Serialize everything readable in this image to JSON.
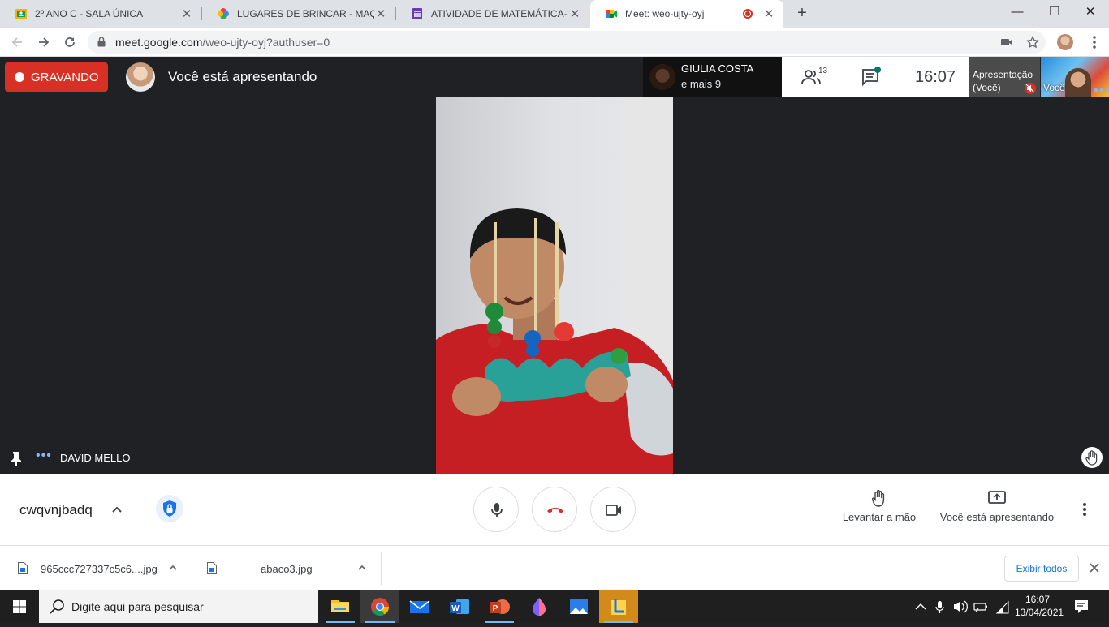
{
  "browser": {
    "tabs": [
      {
        "title": "2º ANO C - SALA ÚNICA",
        "icon": "classroom-icon"
      },
      {
        "title": "LUGARES DE BRINCAR - MAQUETE",
        "icon": "google-photos-icon"
      },
      {
        "title": "ATIVIDADE DE MATEMÁTICA- SISTE",
        "icon": "google-forms-icon"
      },
      {
        "title": "Meet: weo-ujty-oyj",
        "icon": "google-meet-icon",
        "active": true
      }
    ],
    "url_host": "meet.google.com",
    "url_path": "/weo-ujty-oyj?authuser=0"
  },
  "meet": {
    "recording_label": "GRAVANDO",
    "presenting_label": "Você está apresentando",
    "speaker_name": "GIULIA COSTA",
    "speaker_more": "e mais 9",
    "participant_count": "13",
    "time": "16:07",
    "thumb_presentation_line1": "Apresentação",
    "thumb_presentation_line2": "(Você)",
    "thumb_self_label": "Você",
    "tile_name": "DAVID MELLO",
    "meeting_code": "cwqvnjbadq",
    "raise_hand_label": "Levantar a mão",
    "presenting_button_label": "Você está apresentando"
  },
  "downloads": {
    "items": [
      {
        "name": "965ccc727337c5c6....jpg"
      },
      {
        "name": "abaco3.jpg"
      }
    ],
    "show_all": "Exibir todos"
  },
  "taskbar": {
    "search_placeholder": "Digite aqui para pesquisar",
    "apps": [
      "file-explorer-icon",
      "chrome-icon",
      "mail-icon",
      "word-icon",
      "powerpoint-icon",
      "paint3d-icon",
      "photos-icon",
      "sticky-app-icon"
    ],
    "clock_time": "16:07",
    "clock_date": "13/04/2021"
  },
  "colors": {
    "recording_red": "#d93025",
    "meet_dark": "#202124",
    "accent_blue": "#1a73e8"
  }
}
